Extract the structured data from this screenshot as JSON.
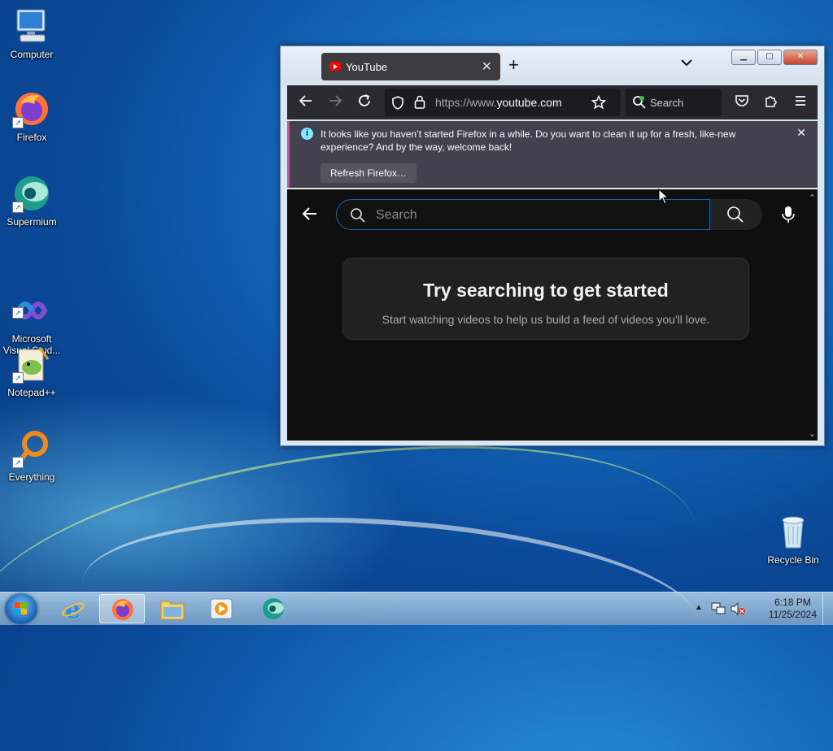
{
  "desktop": {
    "icons": [
      {
        "label": "Computer"
      },
      {
        "label": "Firefox"
      },
      {
        "label": "Supermium"
      },
      {
        "label": "Microsoft\nVisual Stud..."
      },
      {
        "label": "Notepad++"
      },
      {
        "label": "Everything"
      },
      {
        "label": "Recycle Bin"
      }
    ]
  },
  "browser": {
    "tab": {
      "title": "YouTube"
    },
    "url_prefix": "https://www.",
    "url_domain": "youtube.com",
    "search_placeholder": "Search",
    "notification": {
      "message": "It looks like you haven’t started Firefox in a while. Do you want to clean it up for a fresh, like-new experience? And by the way, welcome back!",
      "button": "Refresh Firefox…"
    }
  },
  "youtube": {
    "search_placeholder": "Search",
    "empty_title": "Try searching to get started",
    "empty_subtitle": "Start watching videos to help us build a feed of videos you'll love."
  },
  "taskbar": {
    "time": "6:18 PM",
    "date": "11/25/2024"
  },
  "colors": {
    "accent_youtube": "#ff0000",
    "firefox_toolbar": "#2b2a33",
    "notification_bg": "#42414d",
    "youtube_bg": "#0f0f0f"
  }
}
